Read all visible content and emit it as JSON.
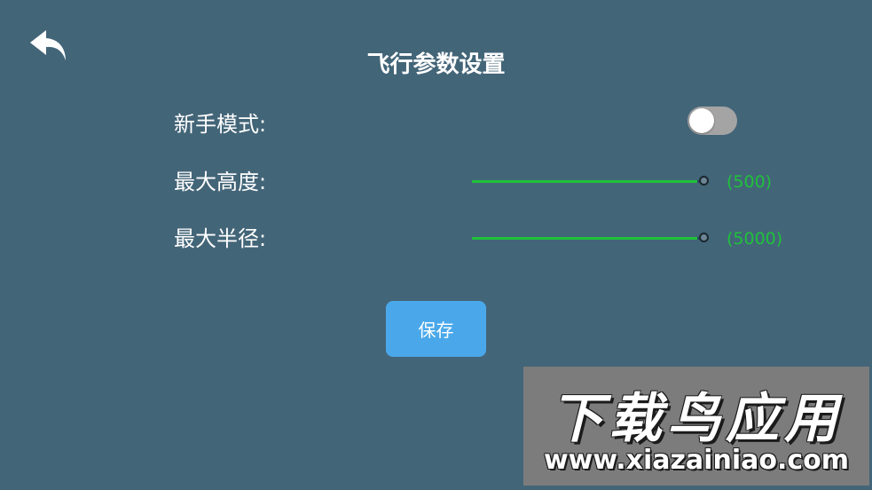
{
  "header": {
    "back_icon": "back-arrow-icon",
    "title": "飞行参数设置"
  },
  "settings": {
    "beginner_mode": {
      "label": "新手模式:",
      "enabled": false
    },
    "max_altitude": {
      "label": "最大高度:",
      "value_text": "(500)",
      "level": 1.0
    },
    "max_radius": {
      "label": "最大半径:",
      "value_text": "(5000)",
      "level": 1.0
    }
  },
  "actions": {
    "save_label": "保存"
  },
  "watermark": {
    "brand": "下载鸟应用",
    "url": "www.xiazainiao.com"
  },
  "colors": {
    "background": "#436578",
    "accent_green": "#1fc23b",
    "button_blue": "#4aa8ea",
    "toggle_off": "#a4a4a4"
  }
}
